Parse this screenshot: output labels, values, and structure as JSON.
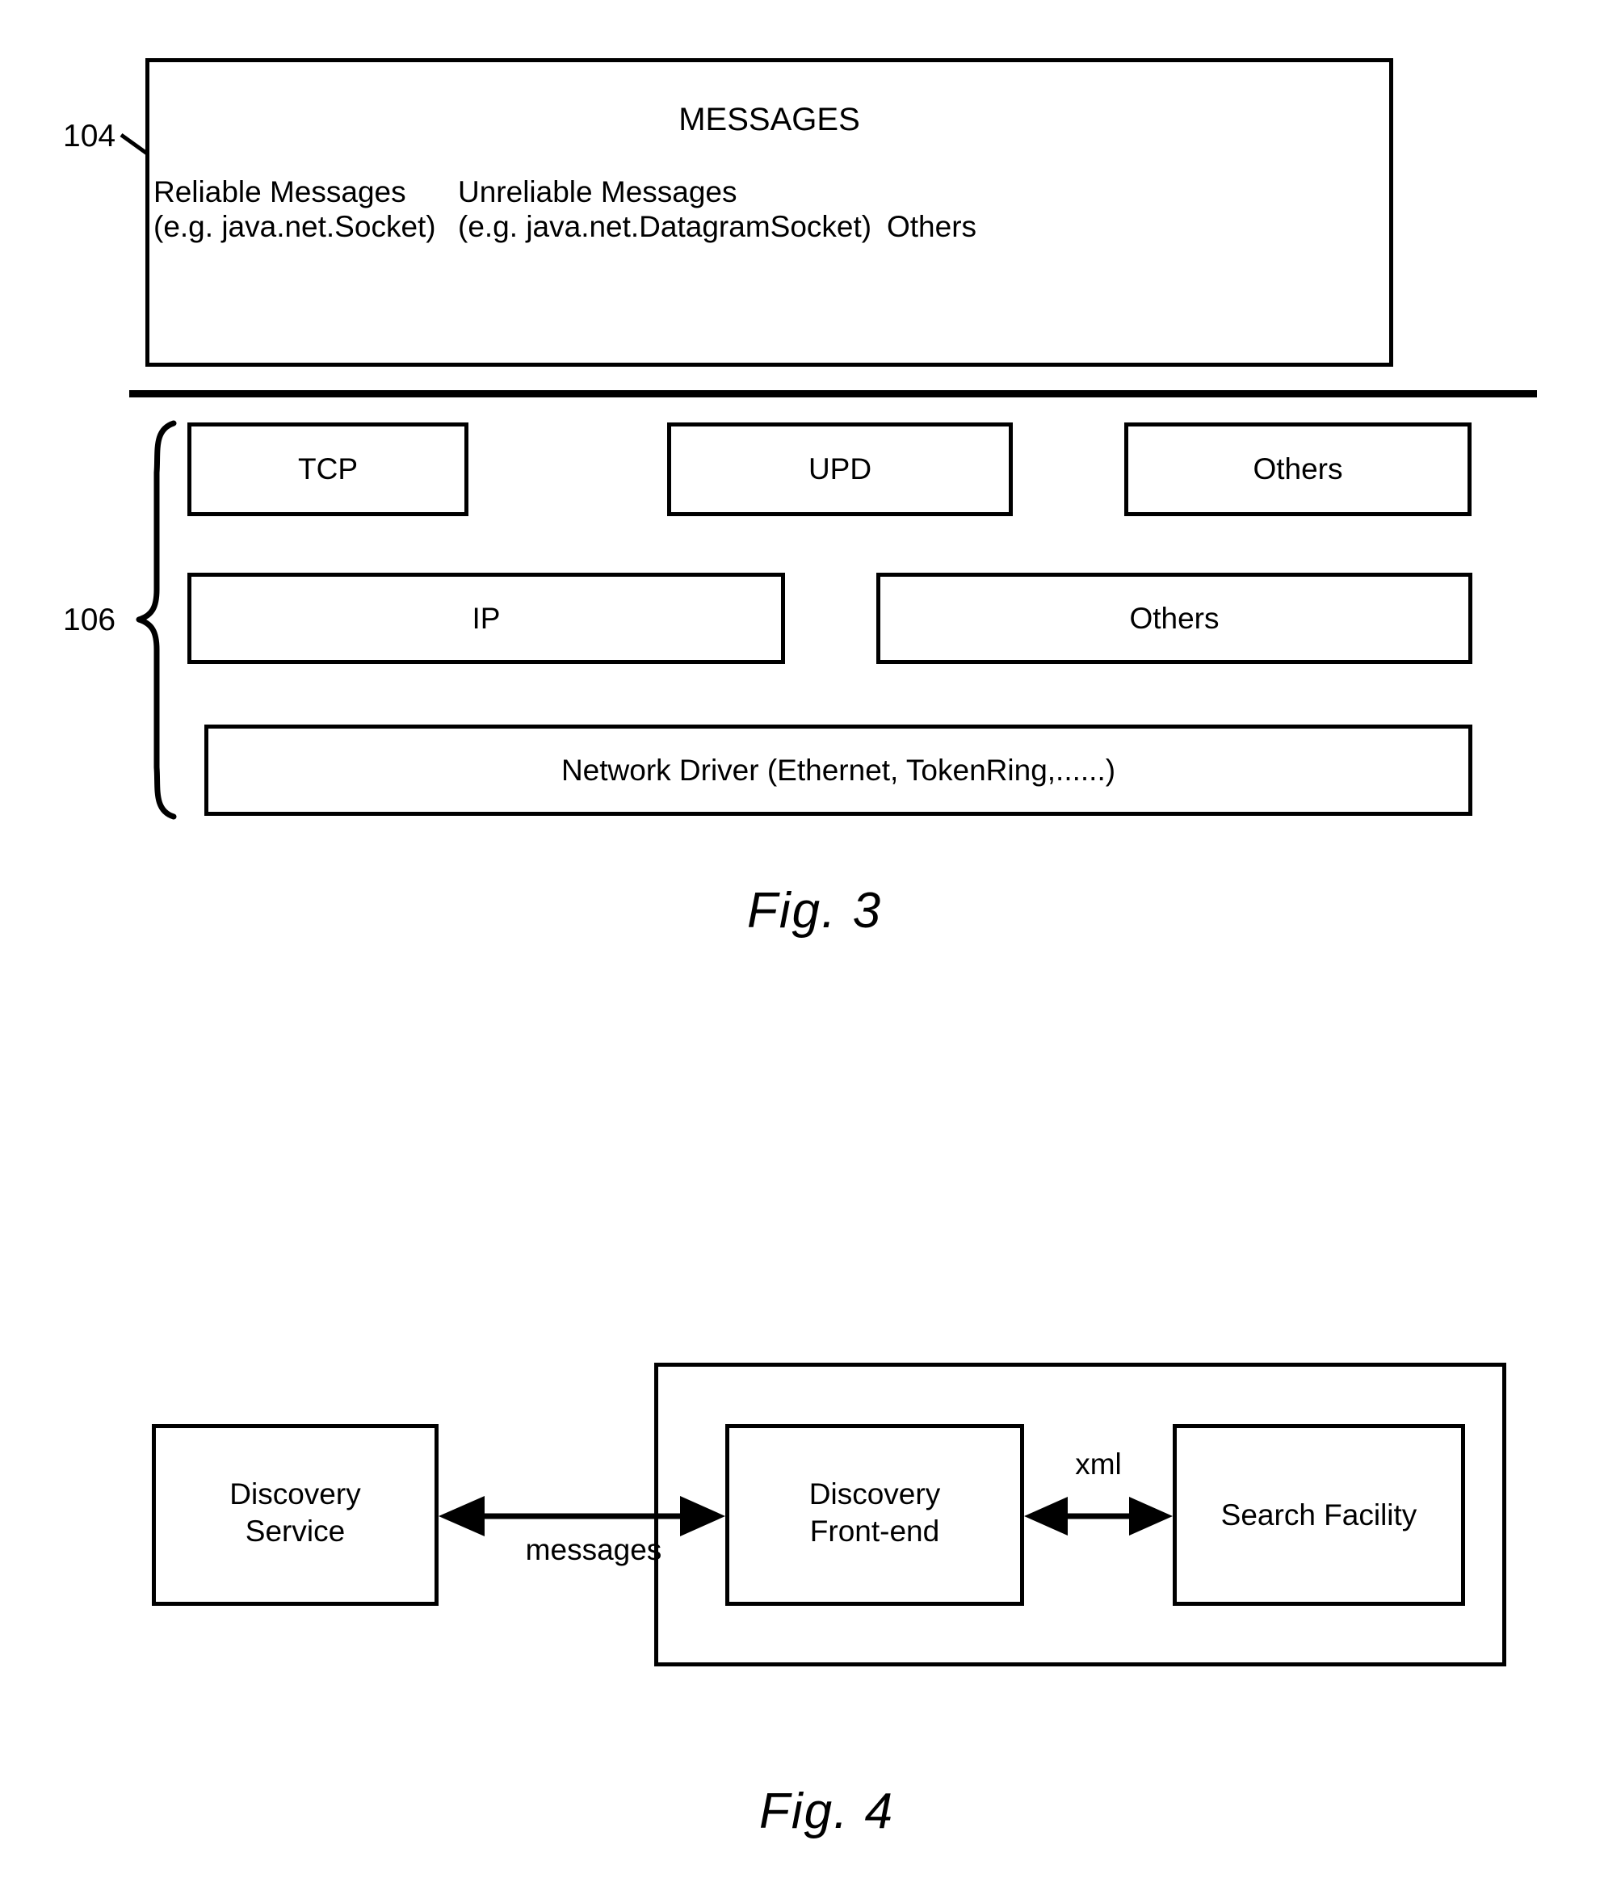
{
  "figures": [
    {
      "id": "fig3",
      "caption": "Fig. 3",
      "reference_numbers": [
        {
          "id": "104",
          "label": "104",
          "points_to": "messages-layer"
        },
        {
          "id": "106",
          "label": "106",
          "points_to": "protocol-stack"
        }
      ],
      "messages_layer": {
        "title": "MESSAGES",
        "items": [
          {
            "name": "Reliable Messages",
            "example": "(e.g. java.net.Socket)"
          },
          {
            "name": "Unreliable Messages",
            "example": "(e.g. java.net.DatagramSocket)"
          },
          {
            "name": "Others",
            "example": ""
          }
        ]
      },
      "protocol_stack": {
        "rows": [
          {
            "boxes": [
              "TCP",
              "UPD",
              "Others"
            ]
          },
          {
            "boxes": [
              "IP",
              "Others"
            ]
          },
          {
            "boxes": [
              "Network Driver (Ethernet, TokenRing,......)"
            ]
          }
        ]
      }
    },
    {
      "id": "fig4",
      "caption": "Fig. 4",
      "boxes": [
        {
          "id": "discovery-service",
          "lines": [
            "Discovery",
            "Service"
          ]
        },
        {
          "id": "discovery-front-end",
          "lines": [
            "Discovery",
            "Front-end"
          ]
        },
        {
          "id": "search-facility",
          "lines": [
            "Search Facility"
          ]
        }
      ],
      "connectors": [
        {
          "id": "messages-link",
          "label": "messages",
          "from": "discovery-service",
          "to": "discovery-front-end",
          "style": "double-arrow"
        },
        {
          "id": "xml-link",
          "label": "xml",
          "from": "discovery-front-end",
          "to": "search-facility",
          "style": "double-arrow"
        }
      ]
    }
  ],
  "colors": {
    "ink": "#000000",
    "paper": "#ffffff"
  }
}
